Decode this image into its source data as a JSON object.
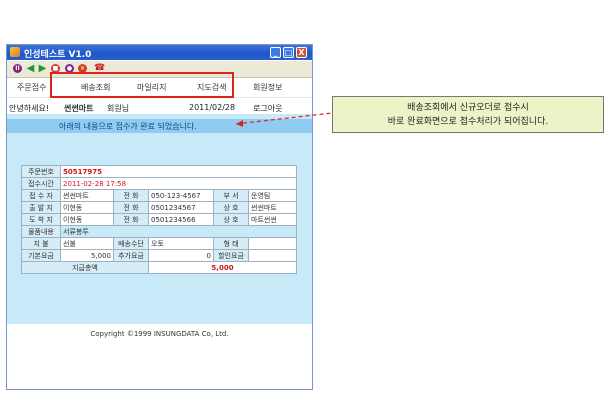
{
  "window": {
    "title": "인성테스트 V1.0"
  },
  "titlebar": {
    "min": "_",
    "max": "□",
    "close": "X"
  },
  "menu": [
    "주문접수",
    "배송조회",
    "마일리지",
    "지도검색",
    "회원정보"
  ],
  "greeting": {
    "hello": "안녕하세요!",
    "name": "썬썬마트",
    "suffix": "회원님",
    "date": "2011/02/28",
    "logout": "로그아웃"
  },
  "notice": "아래의 내용으로 접수가 완료 되었습니다.",
  "order": {
    "no_label": "주문번호",
    "no": "50517975",
    "time_label": "접수시간",
    "time": "2011-02-28 17:58",
    "receiver_label": "접 수 자",
    "receiver": "썬썬마트",
    "r_tel_label": "전 화",
    "r_tel": "050-123-4567",
    "dept_label": "부 서",
    "dept": "운영팀",
    "sender_label": "출 발 지",
    "sender": "이현동",
    "s_tel_label": "전 화",
    "s_tel": "0501234567",
    "s_name_label": "상 호",
    "s_name": "썬썬마트",
    "dest_label": "도 착 지",
    "dest": "이현동",
    "d_tel_label": "전 화",
    "d_tel": "0501234566",
    "d_name_label": "상 호",
    "d_name": "마트썬썬",
    "item_label": "물품내용",
    "item": "서류봉투",
    "pay_label": "지 불",
    "pay": "선불",
    "method_label": "배송수단",
    "method": "오토",
    "type_label": "형 태",
    "type": "",
    "base_label": "기본요금",
    "base": "5,000",
    "extra_label": "추가요금",
    "extra": "0",
    "discount_label": "할인요금",
    "discount": "",
    "total_label": "지급총액",
    "total": "5,000"
  },
  "copyright": "Copyright ©1999 INSUNGDATA Co, Ltd.",
  "callout": {
    "line1": "배송조회에서 신규오더로 접수시",
    "line2": "바로 완료화면으로 접수처리가 되어집니다."
  }
}
